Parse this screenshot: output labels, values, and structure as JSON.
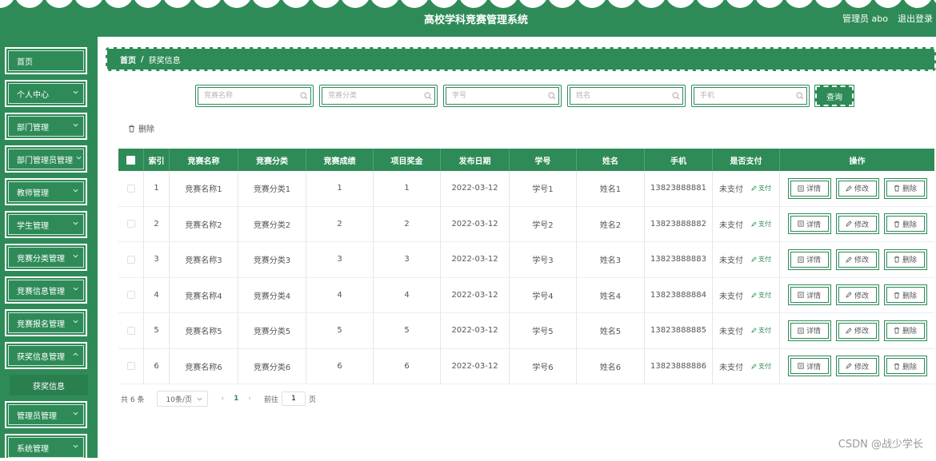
{
  "header": {
    "title": "高校学科竞赛管理系统",
    "user": "管理员 abo",
    "logout": "退出登录"
  },
  "sidebar": {
    "items": [
      {
        "label": "首页"
      },
      {
        "label": "个人中心"
      },
      {
        "label": "部门管理"
      },
      {
        "label": "部门管理员管理"
      },
      {
        "label": "教师管理"
      },
      {
        "label": "学生管理"
      },
      {
        "label": "竞赛分类管理"
      },
      {
        "label": "竞赛信息管理"
      },
      {
        "label": "竞赛报名管理"
      },
      {
        "label": "获奖信息管理"
      },
      {
        "label": "管理员管理"
      },
      {
        "label": "系统管理"
      }
    ],
    "active_sub": "获奖信息"
  },
  "breadcrumb": {
    "home": "首页",
    "sep": "/",
    "current": "获奖信息"
  },
  "search": {
    "fields": [
      {
        "placeholder": "竞赛名称",
        "value": ""
      },
      {
        "placeholder": "竞赛分类",
        "value": ""
      },
      {
        "placeholder": "学号",
        "value": ""
      },
      {
        "placeholder": "姓名",
        "value": ""
      },
      {
        "placeholder": "手机",
        "value": ""
      }
    ],
    "query_label": "查询"
  },
  "toolbar": {
    "delete_label": "删除"
  },
  "table": {
    "headers": [
      "索引",
      "竞赛名称",
      "竞赛分类",
      "竞赛成绩",
      "项目奖金",
      "发布日期",
      "学号",
      "姓名",
      "手机",
      "是否支付",
      "操作"
    ],
    "rows": [
      {
        "idx": "1",
        "name": "竞赛名称1",
        "cat": "竞赛分类1",
        "score": "1",
        "prize": "1",
        "date": "2022-03-12",
        "sno": "学号1",
        "sname": "姓名1",
        "phone": "13823888881",
        "paid": "未支付",
        "pay": "支付"
      },
      {
        "idx": "2",
        "name": "竞赛名称2",
        "cat": "竞赛分类2",
        "score": "2",
        "prize": "2",
        "date": "2022-03-12",
        "sno": "学号2",
        "sname": "姓名2",
        "phone": "13823888882",
        "paid": "未支付",
        "pay": "支付"
      },
      {
        "idx": "3",
        "name": "竞赛名称3",
        "cat": "竞赛分类3",
        "score": "3",
        "prize": "3",
        "date": "2022-03-12",
        "sno": "学号3",
        "sname": "姓名3",
        "phone": "13823888883",
        "paid": "未支付",
        "pay": "支付"
      },
      {
        "idx": "4",
        "name": "竞赛名称4",
        "cat": "竞赛分类4",
        "score": "4",
        "prize": "4",
        "date": "2022-03-12",
        "sno": "学号4",
        "sname": "姓名4",
        "phone": "13823888884",
        "paid": "未支付",
        "pay": "支付"
      },
      {
        "idx": "5",
        "name": "竞赛名称5",
        "cat": "竞赛分类5",
        "score": "5",
        "prize": "5",
        "date": "2022-03-12",
        "sno": "学号5",
        "sname": "姓名5",
        "phone": "13823888885",
        "paid": "未支付",
        "pay": "支付"
      },
      {
        "idx": "6",
        "name": "竞赛名称6",
        "cat": "竞赛分类6",
        "score": "6",
        "prize": "6",
        "date": "2022-03-12",
        "sno": "学号6",
        "sname": "姓名6",
        "phone": "13823888886",
        "paid": "未支付",
        "pay": "支付"
      }
    ],
    "ops": {
      "detail": "详情",
      "edit": "修改",
      "delete": "删除"
    }
  },
  "pagination": {
    "total": "共 6 条",
    "page_size": "10条/页",
    "current": "1",
    "goto": "前往",
    "page_input": "1",
    "page_word": "页"
  },
  "watermark": "CSDN @战少学长",
  "colors": {
    "primary": "#2e8b57",
    "accent_text": "#2e8b57"
  }
}
